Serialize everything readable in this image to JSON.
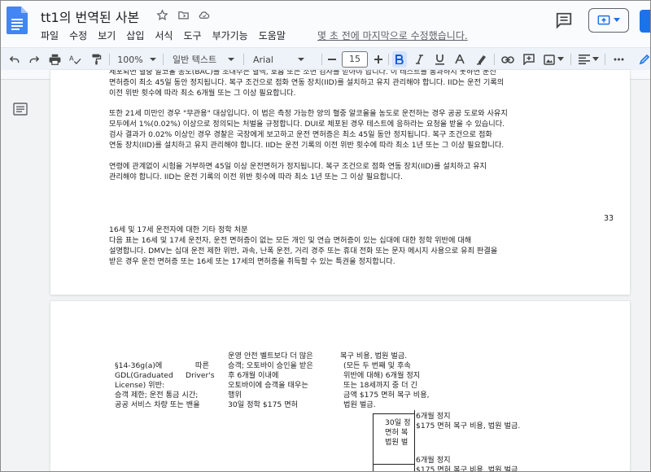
{
  "app": {
    "title": "tt1의 번역된 사본",
    "menu": [
      "파일",
      "수정",
      "보기",
      "삽입",
      "서식",
      "도구",
      "부가기능",
      "도움말"
    ],
    "last_edit": "몇 초 전에 마지막으로 수정했습니다.",
    "accent_color": "#1a73e8"
  },
  "toolbar": {
    "zoom": "100%",
    "style": "일반 텍스트",
    "font": "Arial",
    "font_size": "15",
    "icons": [
      "undo-icon",
      "redo-icon",
      "print-icon",
      "spellcheck-icon",
      "paint-format-icon",
      "decrease-font-icon",
      "increase-font-icon",
      "bold-icon",
      "italic-icon",
      "underline-icon",
      "text-color-icon",
      "highlight-icon",
      "link-icon",
      "comment-icon",
      "image-icon",
      "align-icon",
      "more-icon",
      "edit-icon"
    ]
  },
  "ruler": {
    "left_numbers": [
      "1"
    ],
    "right_numbers": [
      "15",
      "16",
      "17",
      "18",
      "19",
      "20",
      "21"
    ]
  },
  "page1": {
    "lines": [
      "세포되면 혈중 알코올 농도(BAC)를 초대수는 혈액, 호흡 또는 소변 검사를 받아야 합니다. 이 테스트를 통과하지 못하면 운전",
      "면허증이 최소 45일 동안 정지됩니다. 복구 조건으로 점화 연동 장치(IID)를 설치하고 유지 관리해야 합니다. IID는 운전 기록의",
      "이전 위반 횟수에 따라 최소 6개월 또는 그 이상 필요합니다.",
      "또한 21세 미만인 경우 \"무관용\" 대상입니다. 이 법은 측정 가능한 양의 혈중 알코올을 농도로 운전하는 경우 공공 도로와 사유지",
      "모두에서 1%(0.02%) 이상으로 정의되는 처벌을 규정합니다. DUI로 체포된 경우 테스트에 응하라는 요청을 받을 수 있습니다.",
      "검사 결과가 0.02% 이상인 경우 경찰은 국장에게 보고하고 운전 면허증은 최소 45일 동안 정지됩니다. 복구 조건으로 점화",
      "연동 장치(IID)를 설치하고 유지 관리해야 합니다. IID는 운전 기록의 이전 위반 횟수에 따라 최소 1년 또는 그 이상 필요합니다.",
      "연령에 관계없이 시험을 거부하면 45일 이상 운전면허가 정지됩니다. 복구 조건으로 점화 연동 장치(IID)를 설치하고 유지",
      "관리해야 합니다. IID는 운전 기록의 이전 위반 횟수에 따라 최소 1년 또는 그 이상 필요합니다.",
      "16세 및 17세 운전자에 대한 기타 정학 처분",
      "다음 표는 16세 및 17세 운전자, 운전 면허증이 없는 모든 개인 및 연습 면허증이 있는 십대에 대한 정학 위반에 대해",
      "설명합니다. DMV는 십대 운전 제한 위반, 과속, 난폭 운전, 거리 경주 또는 휴대 전화 또는 문자 메시지 사용으로 유죄 판결을",
      "받은 경우 운전 면허증 또는 16세 또는 17세의 면허증을 취득할 수 있는 특권을 정지합니다."
    ],
    "page_number": "33"
  },
  "page2": {
    "col1": [
      "§14-36g(a)에",
      "GDL(Graduated",
      "License) 위반:",
      "승객 제한; 운전 통금 시간;",
      "공공 서비스 차량 또는 밴을"
    ],
    "col1b": [
      "따른",
      "Driver's"
    ],
    "col2": [
      "운영 안전 벨트보다 더 많은",
      "승객; 오토바이 승인을 받은",
      "후 6개월 이내에",
      "오토바이에 승객을 태우는",
      "행위",
      " 30일 정학 $175 면허"
    ],
    "col3": [
      "복구 비용, 법원 벌금.",
      "(모든 두 번째 및 후속",
      "위반에 대해) 6개월 정지",
      "또는 18세까지 중 더 긴",
      "금액 $175 면허 복구 비용,",
      "법원 벌금."
    ],
    "sub_left": [
      "30일 정",
      "면허 복",
      "법원 벌"
    ],
    "sub_right1": [
      "6개월 정지",
      "$175 면허 복구 비용, 법원 벌금."
    ],
    "sub_right2": [
      "6개월 정지",
      "$175 면허 복구 비용, 법원 벌금."
    ]
  }
}
